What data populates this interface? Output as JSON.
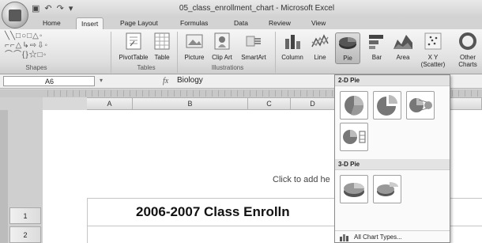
{
  "window": {
    "title": "05_class_enrollment_chart - Microsoft Excel"
  },
  "tabs": [
    "Home",
    "Insert",
    "Page Layout",
    "Formulas",
    "Data",
    "Review",
    "View"
  ],
  "active_tab": "Insert",
  "ribbon": {
    "groups": {
      "shapes": "Shapes",
      "tables": "Tables",
      "illustrations": "Illustrations"
    },
    "buttons": {
      "pivottable": "PivotTable",
      "table": "Table",
      "picture": "Picture",
      "clipart": "Clip Art",
      "smartart": "SmartArt",
      "column": "Column",
      "line": "Line",
      "pie": "Pie",
      "bar": "Bar",
      "area": "Area",
      "scatter": "X Y (Scatter)",
      "other": "Other Charts"
    }
  },
  "formula_bar": {
    "name_box": "A6",
    "fx": "fx",
    "value": "Biology"
  },
  "columns": [
    "A",
    "B",
    "C",
    "D"
  ],
  "rows": [
    "1",
    "2"
  ],
  "sheet": {
    "click_hint": "Click to add he",
    "title": "2006-2007 Class Enrolln"
  },
  "gallery": {
    "section_2d": "2-D Pie",
    "section_3d": "3-D Pie",
    "footer": "All Chart Types..."
  }
}
